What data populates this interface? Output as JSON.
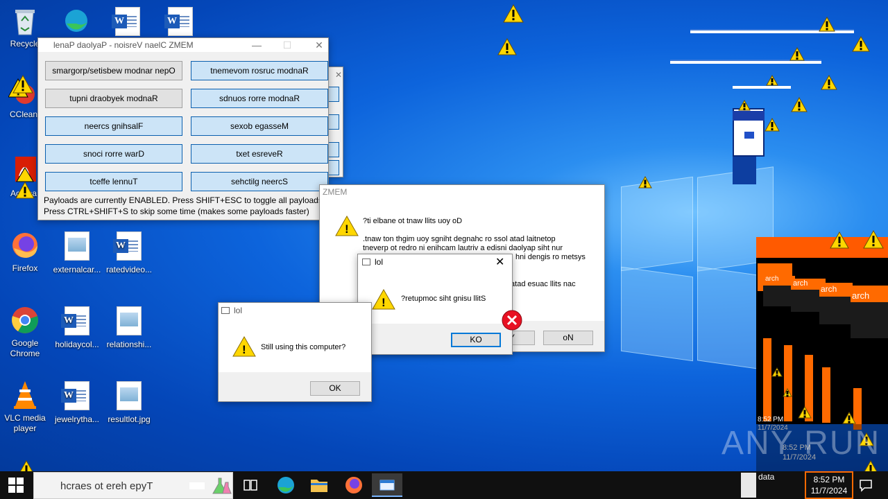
{
  "desktop_icons": [
    {
      "id": "recycle",
      "label": "Recycle",
      "icon": "recycle-bin-icon"
    },
    {
      "id": "ccleaner",
      "label": "CClean",
      "icon": "ccleaner-icon"
    },
    {
      "id": "acrobat",
      "label": "Acroba",
      "icon": "acrobat-icon"
    },
    {
      "id": "firefox",
      "label": "Firefox",
      "icon": "firefox-icon"
    },
    {
      "id": "externalcar",
      "label": "externalcar...",
      "icon": "image-file-icon"
    },
    {
      "id": "ratedvideo",
      "label": "ratedvideo...",
      "icon": "word-doc-icon"
    },
    {
      "id": "chrome",
      "label": "Google Chrome",
      "icon": "chrome-icon"
    },
    {
      "id": "holidaycol",
      "label": "holidaycol...",
      "icon": "word-doc-icon"
    },
    {
      "id": "relationshi",
      "label": "relationshi...",
      "icon": "image-file-icon"
    },
    {
      "id": "vlc",
      "label": "VLC media player",
      "icon": "vlc-icon"
    },
    {
      "id": "jewelrytha",
      "label": "jewelrytha...",
      "icon": "word-doc-icon"
    },
    {
      "id": "resultlot",
      "label": "resultlot.jpg",
      "icon": "image-file-icon"
    }
  ],
  "memz_panel": {
    "title": "lenaP daolyaP - noisreV naelC ZMEM",
    "buttons": [
      {
        "label": "smargorp/setisbew modnar nepO",
        "style": "gray"
      },
      {
        "label": "tnemevom rosruc modnaR",
        "style": "blue"
      },
      {
        "label": "tupni draobyek modnaR",
        "style": "gray"
      },
      {
        "label": "sdnuos rorre modnaR",
        "style": "blue"
      },
      {
        "label": "neercs gnihsalF",
        "style": "blue"
      },
      {
        "label": "sexob egasseM",
        "style": "blue"
      },
      {
        "label": "snoci rorre warD",
        "style": "blue"
      },
      {
        "label": "txet esreveR",
        "style": "blue"
      },
      {
        "label": "tceffe lennuT",
        "style": "blue"
      },
      {
        "label": "sehctilg neercS",
        "style": "blue"
      }
    ],
    "status_line1": "Payloads are currently ENABLED. Press SHIFT+ESC to toggle all payloads!",
    "status_line2": "Press CTRL+SHIFT+S to skip some time (makes some payloads faster)"
  },
  "memz_dialog": {
    "title": "ZMEM",
    "line1": "?ti elbane ot tnaw llits uoy oD",
    "line2": ".tnaw ton thgim uoy sgniht degnahc ro ssol atad laitnetop",
    "line3": "tneverp ot redro ni enihcam lautriv a edisni daolyap siht nur",
    "line4": "hni dengis ro metsys",
    "line5": "tatad esuac llits nac",
    "yes_fragment": "Y",
    "no_label": "oN"
  },
  "lol_dialog_reversed": {
    "title": "lol",
    "message": "?retupmoc siht gnisu llitS",
    "ok_label": "KO"
  },
  "lol_dialog": {
    "title": "lol",
    "message": "Still using this computer?",
    "ok_label": "OK"
  },
  "glitch_texts": {
    "search1": "arch",
    "search2": "arch",
    "search3": "arch",
    "search4": "arch",
    "data": "data",
    "time_small": "8:52 PM",
    "date_small": "11/7/2024",
    "time_mid": "8:52 PM",
    "date_mid": "11/7/2024"
  },
  "taskbar": {
    "search_placeholder": "hcraes ot ereh epyT",
    "time": "8:52 PM",
    "date": "11/7/2024",
    "tray_data": "data"
  },
  "watermark": "ANY RUN",
  "colors": {
    "accent": "#0078d7",
    "desktop": "#0d64dc",
    "warning": "#ffd700"
  }
}
